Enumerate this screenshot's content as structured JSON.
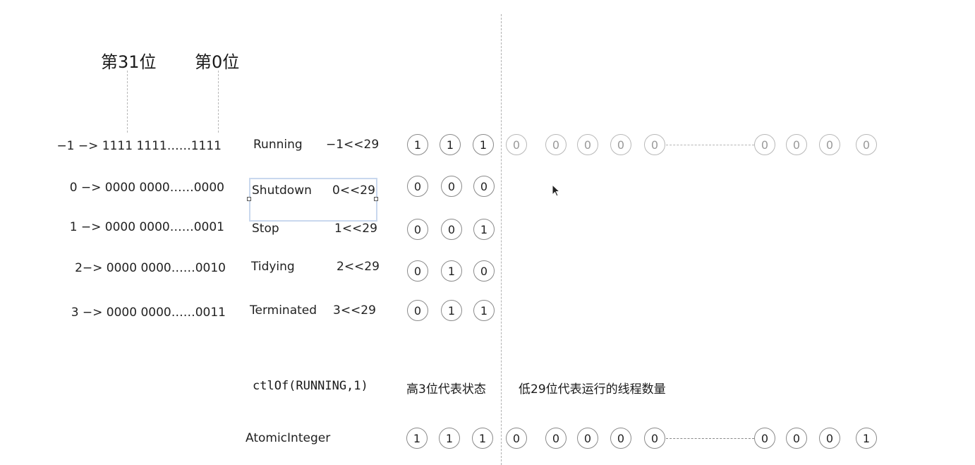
{
  "header": {
    "bit31_label": "第31位",
    "bit0_label": "第0位"
  },
  "binary_rows": [
    "−1 −> 1111 1111……1111",
    "0 −> 0000 0000……0000",
    "1 −> 0000 0000……0001",
    "2−> 0000 0000……0010",
    "3 −> 0000 0000……0011"
  ],
  "states": [
    {
      "name": "Running",
      "shift": "−1<<29",
      "bits": [
        "1",
        "1",
        "1"
      ]
    },
    {
      "name": "Shutdown",
      "shift": "0<<29",
      "bits": [
        "0",
        "0",
        "0"
      ]
    },
    {
      "name": "Stop",
      "shift": "1<<29",
      "bits": [
        "0",
        "0",
        "1"
      ]
    },
    {
      "name": "Tidying",
      "shift": "2<<29",
      "bits": [
        "0",
        "1",
        "0"
      ]
    },
    {
      "name": "Terminated",
      "shift": "3<<29",
      "bits": [
        "0",
        "1",
        "1"
      ]
    }
  ],
  "running_low_bits": {
    "left": [
      "0",
      "0",
      "0",
      "0",
      "0"
    ],
    "right": [
      "0",
      "0",
      "0",
      "0"
    ]
  },
  "ctl": {
    "code": "ctlOf(RUNNING,1)",
    "high_note": "高3位代表状态",
    "low_note": "低29位代表运行的线程数量"
  },
  "atomic": {
    "label": "AtomicInteger",
    "high_bits": [
      "1",
      "1",
      "1"
    ],
    "low_left": [
      "0",
      "0",
      "0",
      "0",
      "0"
    ],
    "low_right": [
      "0",
      "0",
      "0",
      "1"
    ]
  },
  "icons": {
    "cursor": "mouse-pointer-icon"
  }
}
